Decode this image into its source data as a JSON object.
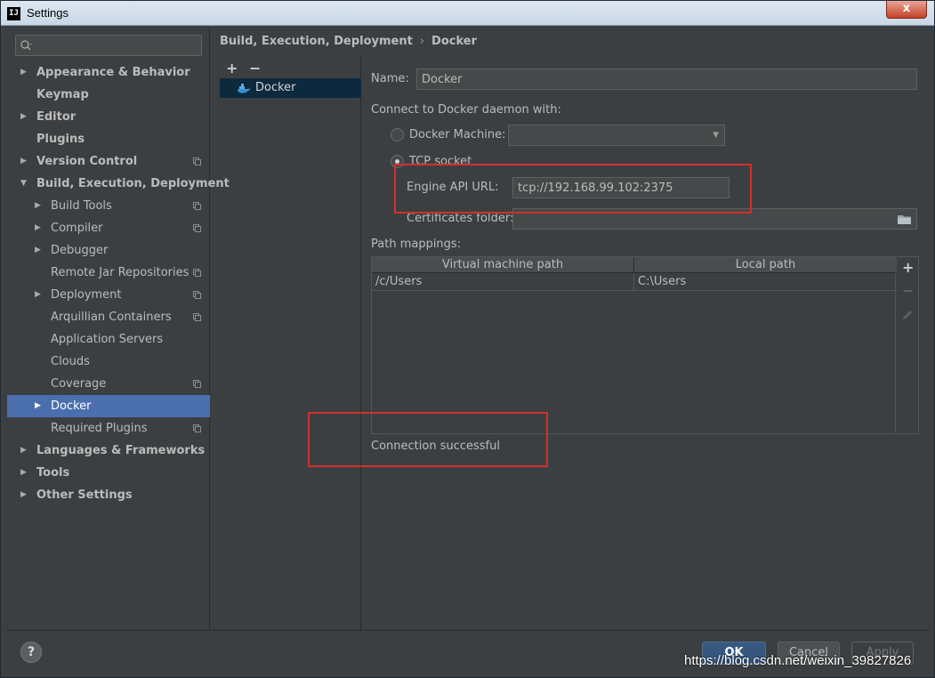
{
  "window": {
    "title": "Settings",
    "app_icon_text": "IJ",
    "close_label": "x"
  },
  "search": {
    "value": "",
    "placeholder": ""
  },
  "sidebar": {
    "items": [
      {
        "label": "Appearance & Behavior",
        "bold": true,
        "arrow": "right",
        "level": 0
      },
      {
        "label": "Keymap",
        "bold": true,
        "arrow": "",
        "level": 0
      },
      {
        "label": "Editor",
        "bold": true,
        "arrow": "right",
        "level": 0
      },
      {
        "label": "Plugins",
        "bold": true,
        "arrow": "",
        "level": 0
      },
      {
        "label": "Version Control",
        "bold": true,
        "arrow": "right",
        "level": 0,
        "copy": true
      },
      {
        "label": "Build, Execution, Deployment",
        "bold": true,
        "arrow": "down",
        "level": 0
      },
      {
        "label": "Build Tools",
        "bold": false,
        "arrow": "right",
        "level": 1,
        "copy": true
      },
      {
        "label": "Compiler",
        "bold": false,
        "arrow": "right",
        "level": 1,
        "copy": true
      },
      {
        "label": "Debugger",
        "bold": false,
        "arrow": "right",
        "level": 1
      },
      {
        "label": "Remote Jar Repositories",
        "bold": false,
        "arrow": "",
        "level": 1,
        "copy": true
      },
      {
        "label": "Deployment",
        "bold": false,
        "arrow": "right",
        "level": 1,
        "copy": true
      },
      {
        "label": "Arquillian Containers",
        "bold": false,
        "arrow": "",
        "level": 1,
        "copy": true
      },
      {
        "label": "Application Servers",
        "bold": false,
        "arrow": "",
        "level": 1
      },
      {
        "label": "Clouds",
        "bold": false,
        "arrow": "",
        "level": 1
      },
      {
        "label": "Coverage",
        "bold": false,
        "arrow": "",
        "level": 1,
        "copy": true
      },
      {
        "label": "Docker",
        "bold": false,
        "arrow": "right",
        "level": 1,
        "selected": true
      },
      {
        "label": "Required Plugins",
        "bold": false,
        "arrow": "",
        "level": 1,
        "copy": true
      },
      {
        "label": "Languages & Frameworks",
        "bold": true,
        "arrow": "right",
        "level": 0
      },
      {
        "label": "Tools",
        "bold": true,
        "arrow": "right",
        "level": 0
      },
      {
        "label": "Other Settings",
        "bold": true,
        "arrow": "right",
        "level": 0
      }
    ]
  },
  "breadcrumb": {
    "parent": "Build, Execution, Deployment",
    "separator": "›",
    "current": "Docker"
  },
  "list": {
    "add": "+",
    "remove": "−",
    "items": [
      {
        "label": "Docker"
      }
    ]
  },
  "form": {
    "name_label": "Name:",
    "name_value": "Docker",
    "connect_label": "Connect to Docker daemon with:",
    "docker_machine_label": "Docker Machine:",
    "docker_machine_value": "",
    "tcp_label": "TCP socket",
    "engine_url_label": "Engine API URL:",
    "engine_url_value": "tcp://192.168.99.102:2375",
    "certs_label": "Certificates folder:",
    "certs_value": "",
    "path_mappings_label": "Path mappings:",
    "mappings_headers": [
      "Virtual machine path",
      "Local path"
    ],
    "mappings_rows": [
      [
        "/c/Users",
        "C:\\Users"
      ]
    ],
    "status": "Connection successful"
  },
  "buttons": {
    "help": "?",
    "ok": "OK",
    "cancel": "Cancel",
    "apply": "Apply"
  },
  "watermark": "https://blog.csdn.net/weixin_39827826",
  "colors": {
    "selection": "#4b6eaf",
    "highlight_box": "#d32f2f",
    "background": "#3c3f41"
  }
}
